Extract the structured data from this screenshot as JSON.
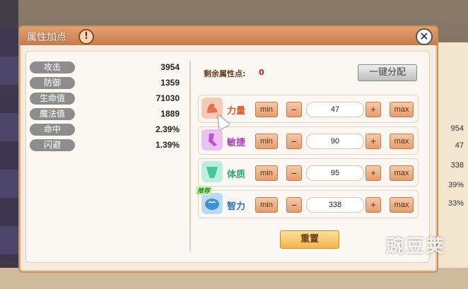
{
  "window": {
    "title": "属性加点",
    "info_icon": "!",
    "close_icon": "✕"
  },
  "stats": [
    {
      "label": "攻击",
      "value": "3954"
    },
    {
      "label": "防御",
      "value": "1359"
    },
    {
      "label": "生命值",
      "value": "71030"
    },
    {
      "label": "魔法值",
      "value": "1889"
    },
    {
      "label": "命中",
      "value": "2.39%"
    },
    {
      "label": "闪避",
      "value": "1.39%"
    }
  ],
  "remaining": {
    "label": "剩余属性点:",
    "value": "0"
  },
  "auto_assign_label": "一键分配",
  "attributes": [
    {
      "name": "力量",
      "value": "47",
      "icon": "muscle-arm-icon",
      "color": "#e8714a",
      "name_color": "#e05a2a"
    },
    {
      "name": "敏捷",
      "value": "90",
      "icon": "running-leg-icon",
      "color": "#c24fd1",
      "name_color": "#a23fc2"
    },
    {
      "name": "体质",
      "value": "95",
      "icon": "torso-icon",
      "color": "#3fc99c",
      "name_color": "#27a57a"
    },
    {
      "name": "智力",
      "value": "338",
      "icon": "brain-icon",
      "color": "#3f8fd8",
      "name_color": "#2b74c0",
      "tag": "推荐"
    }
  ],
  "buttons": {
    "min": "min",
    "dec": "−",
    "inc": "+",
    "max": "max",
    "reset": "重置"
  },
  "watermark": "豌豆荚",
  "background": {
    "right_values": [
      "954",
      "47",
      "338",
      "39%",
      "33%"
    ]
  }
}
